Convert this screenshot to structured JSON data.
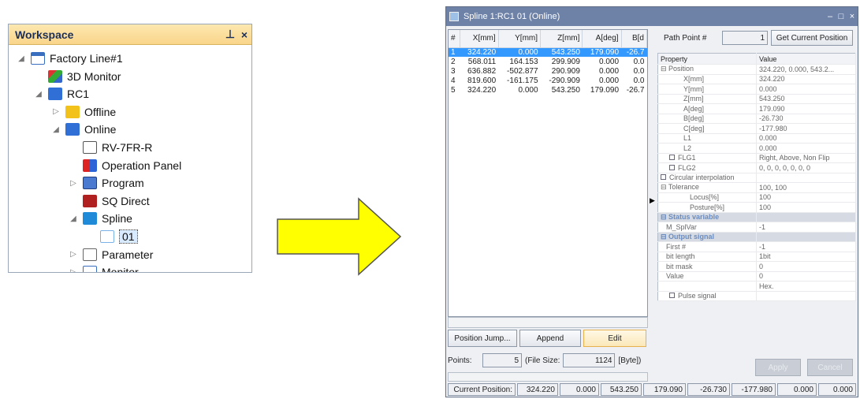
{
  "workspace": {
    "title": "Workspace",
    "pin_glyph": "⊥",
    "close_glyph": "×",
    "tree": [
      {
        "label": "Factory Line#1",
        "icon": "factory-line-icon",
        "expander": "◢"
      },
      {
        "label": "3D Monitor",
        "icon": "3d-monitor-icon",
        "expander": ""
      },
      {
        "label": "RC1",
        "icon": "robot-controller-icon",
        "expander": "◢"
      },
      {
        "label": "Offline",
        "icon": "offline-icon",
        "expander": "▷"
      },
      {
        "label": "Online",
        "icon": "online-icon",
        "expander": "◢"
      },
      {
        "label": "RV-7FR-R",
        "icon": "robot-model-icon",
        "expander": ""
      },
      {
        "label": "Operation Panel",
        "icon": "operation-panel-icon",
        "expander": ""
      },
      {
        "label": "Program",
        "icon": "program-icon",
        "expander": "▷"
      },
      {
        "label": "SQ Direct",
        "icon": "sq-direct-icon",
        "expander": ""
      },
      {
        "label": "Spline",
        "icon": "spline-icon",
        "expander": "◢"
      },
      {
        "label": "01",
        "icon": "spline-file-icon",
        "expander": ""
      },
      {
        "label": "Parameter",
        "icon": "parameter-icon",
        "expander": "▷"
      },
      {
        "label": "Monitor",
        "icon": "monitor-icon",
        "expander": "▷"
      }
    ]
  },
  "arrow": {
    "color": "#ffff00",
    "outline": "#555555"
  },
  "window": {
    "title": "Spline 1:RC1 01 (Online)",
    "min_glyph": "–",
    "max_glyph": "□",
    "close_glyph": "×"
  },
  "points_table": {
    "headers": [
      "#",
      "X[mm]",
      "Y[mm]",
      "Z[mm]",
      "A[deg]",
      "B[d"
    ],
    "rows": [
      [
        "1",
        "324.220",
        "0.000",
        "543.250",
        "179.090",
        "-26.7"
      ],
      [
        "2",
        "568.011",
        "164.153",
        "299.909",
        "0.000",
        "0.0"
      ],
      [
        "3",
        "636.882",
        "-502.877",
        "290.909",
        "0.000",
        "0.0"
      ],
      [
        "4",
        "819.600",
        "-161.175",
        "-290.909",
        "0.000",
        "0.0"
      ],
      [
        "5",
        "324.220",
        "0.000",
        "543.250",
        "179.090",
        "-26.7"
      ]
    ]
  },
  "buttons": {
    "position_jump": "Position Jump...",
    "append": "Append",
    "edit": "Edit",
    "get_current_position": "Get Current Position",
    "apply": "Apply",
    "cancel": "Cancel"
  },
  "points_info": {
    "points_label": "Points:",
    "points_value": "5",
    "file_size_label": "(File Size:",
    "file_size_value": "1124",
    "file_size_unit": "[Byte])"
  },
  "path_point": {
    "label": "Path Point #",
    "value": "1"
  },
  "properties": {
    "header_property": "Property",
    "header_value": "Value",
    "rows": [
      {
        "name": "⊟ Position",
        "value": "324.220, 0.000, 543.2...",
        "type": "group"
      },
      {
        "name": "X[mm]",
        "value": "324.220",
        "type": "sub"
      },
      {
        "name": "Y[mm]",
        "value": "0.000",
        "type": "sub"
      },
      {
        "name": "Z[mm]",
        "value": "543.250",
        "type": "sub"
      },
      {
        "name": "A[deg]",
        "value": "179.090",
        "type": "sub"
      },
      {
        "name": "B[deg]",
        "value": "-26.730",
        "type": "sub"
      },
      {
        "name": "C[deg]",
        "value": "-177.980",
        "type": "sub"
      },
      {
        "name": "L1",
        "value": "0.000",
        "type": "sub"
      },
      {
        "name": "L2",
        "value": "0.000",
        "type": "sub"
      },
      {
        "name": "FLG1",
        "value": "Right, Above, Non Flip",
        "type": "flag"
      },
      {
        "name": "FLG2",
        "value": "0, 0, 0, 0, 0, 0, 0",
        "type": "flag"
      },
      {
        "name": "Circular interpolation",
        "value": "",
        "type": "check"
      },
      {
        "name": "⊟ Tolerance",
        "value": "100, 100",
        "type": "group"
      },
      {
        "name": "Locus[%]",
        "value": "100",
        "type": "sub2"
      },
      {
        "name": "Posture[%]",
        "value": "100",
        "type": "sub2"
      },
      {
        "name": "⊟ Status variable",
        "value": "",
        "type": "cat"
      },
      {
        "name": "M_SplVar",
        "value": "-1",
        "type": "plain"
      },
      {
        "name": "⊟ Output signal",
        "value": "",
        "type": "cat"
      },
      {
        "name": "First #",
        "value": "-1",
        "type": "plain"
      },
      {
        "name": "bit length",
        "value": "1bit",
        "type": "plain"
      },
      {
        "name": "bit mask",
        "value": "0",
        "type": "plain"
      },
      {
        "name": "Value",
        "value": "0",
        "type": "plain"
      },
      {
        "name": "",
        "value": "Hex.",
        "type": "plain"
      },
      {
        "name": "Pulse signal",
        "value": "",
        "type": "check"
      }
    ]
  },
  "status_bar": {
    "label": "Current Position:",
    "values": [
      "324.220",
      "0.000",
      "543.250",
      "179.090",
      "-26.730",
      "-177.980",
      "0.000",
      "0.000"
    ]
  }
}
